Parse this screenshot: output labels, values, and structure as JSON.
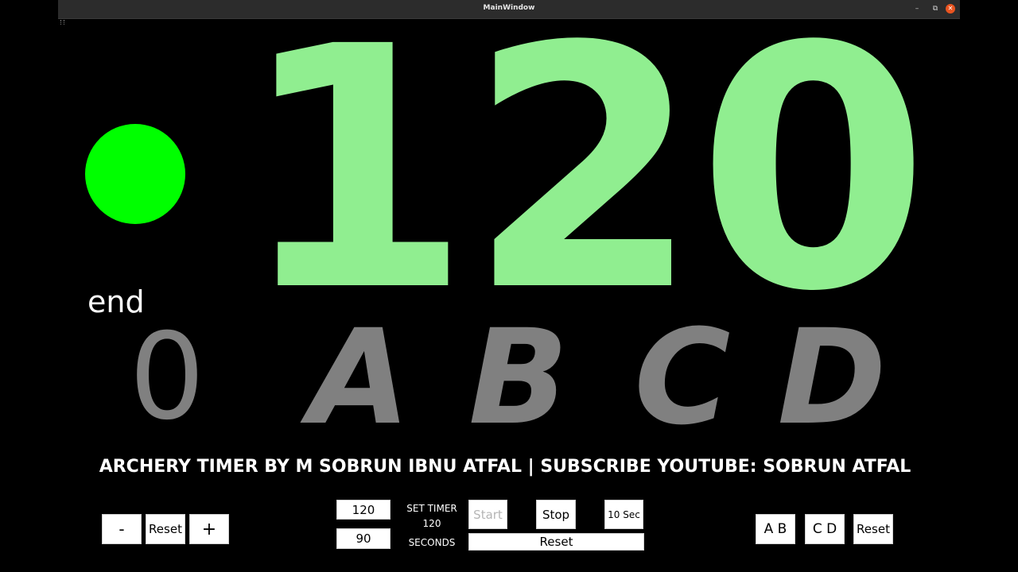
{
  "window": {
    "title": "MainWindow",
    "minimize_glyph": "–",
    "maximize_glyph": "⧉",
    "close_glyph": "✕"
  },
  "display": {
    "countdown": "120",
    "status_light_color": "#00ff00",
    "end_label": "end",
    "end_count": "0",
    "groups": [
      "A",
      "B",
      "C",
      "D"
    ],
    "countdown_color": "#90ee90",
    "inactive_color": "#808080"
  },
  "banner": "ARCHERY TIMER BY M SOBRUN IBNU ATFAL | SUBSCRIBE YOUTUBE: SOBRUN ATFAL",
  "end_controls": {
    "minus_label": "-",
    "reset_label": "Reset",
    "plus_label": "+"
  },
  "timer_controls": {
    "preset_1": "120",
    "preset_2": "90",
    "set_timer_label": "SET TIMER",
    "current_value": "120",
    "seconds_label": "SECONDS",
    "start_label": "Start",
    "stop_label": "Stop",
    "ten_sec_label": "10 Sec",
    "reset_label": "Reset"
  },
  "group_controls": {
    "ab_label": "A B",
    "cd_label": "C D",
    "reset_label": "Reset"
  }
}
